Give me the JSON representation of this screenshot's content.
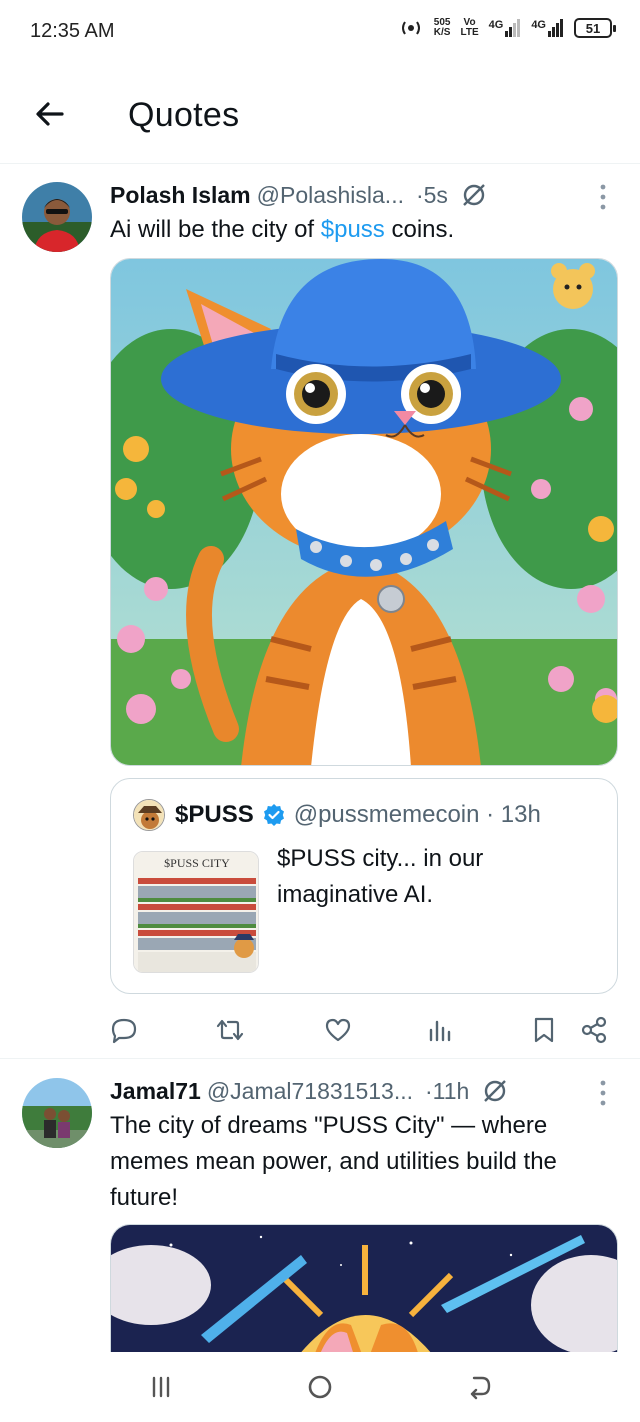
{
  "status_bar": {
    "time": "12:35 AM",
    "speed_value": "505",
    "speed_unit": "K/S",
    "volte_top": "Vo",
    "volte_bottom": "LTE",
    "net1": "4G",
    "net2": "4G",
    "battery": "51"
  },
  "header": {
    "title": "Quotes",
    "back_icon": "arrow-left-icon"
  },
  "tweets": [
    {
      "name": "Polash Islam",
      "handle": "@Polashisla...",
      "time": "·5s",
      "text_before": "Ai will be the city of ",
      "cashtag": "$puss",
      "text_after": " coins.",
      "quote": {
        "name": "$PUSS",
        "handle": "@pussmemecoin · 13h",
        "text": "$PUSS city... in our imaginative AI.",
        "thumb_title": "$PUSS CITY"
      }
    },
    {
      "name": "Jamal71",
      "handle": "@Jamal71831513...",
      "time": "·11h",
      "text": "The city of dreams \"PUSS City\" — where memes mean power, and utilities build the future!"
    }
  ],
  "icons": {
    "reply": "reply-icon",
    "retweet": "retweet-icon",
    "like": "heart-icon",
    "views": "views-icon",
    "bookmark": "bookmark-icon",
    "share": "share-icon",
    "grok": "grok-icon",
    "more": "more-vertical-icon"
  },
  "colors": {
    "accent": "#1d9bf0",
    "text": "#0f1419",
    "secondary": "#536471"
  }
}
